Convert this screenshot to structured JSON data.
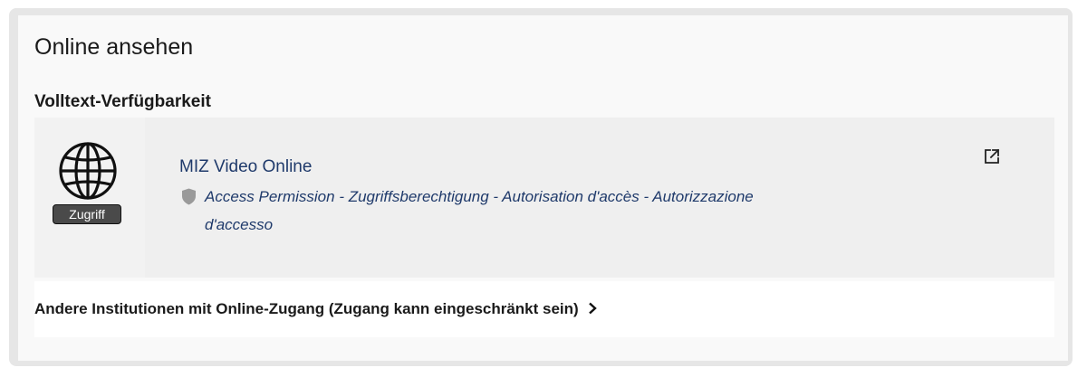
{
  "panel": {
    "title": "Online ansehen",
    "section_heading": "Volltext-Verfügbarkeit"
  },
  "access": {
    "badge": "Zugriff",
    "resource_link": "MIZ Video Online",
    "permission": "Access Permission - Zugriffsberechtigung - Autorisation d'accès - Autorizzazione d'accesso",
    "icons": [
      "globe-icon",
      "shield-icon",
      "external-link-icon"
    ]
  },
  "other": {
    "link_label": "Andere Institutionen mit Online-Zugang (Zugang kann eingeschränkt sein)",
    "icon": "chevron-right-icon"
  },
  "colors": {
    "link": "#1f3a6b",
    "badge_bg": "#4a4a4a",
    "shield": "#9a9a9a",
    "box_bg": "#efefef"
  }
}
